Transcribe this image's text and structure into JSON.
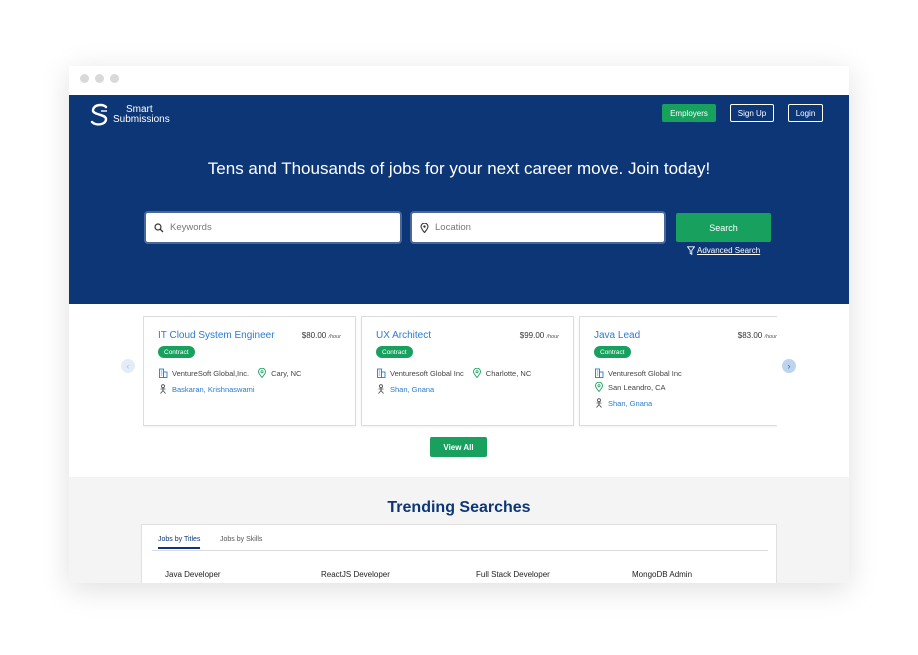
{
  "colors": {
    "brand_navy": "#0d3677",
    "accent_green": "#18a05e",
    "link_blue": "#2a7bd0"
  },
  "logo": {
    "line1": "Smart",
    "line2": "Submissions",
    "icon": "s-logo-icon"
  },
  "nav": {
    "employers": "Employers",
    "signup": "Sign Up",
    "login": "Login"
  },
  "hero": {
    "headline": "Tens and Thousands of jobs for your next career move. Join today!"
  },
  "search": {
    "keywords_placeholder": "Keywords",
    "location_placeholder": "Location",
    "button": "Search",
    "advanced": "Advanced Search"
  },
  "jobs": [
    {
      "title": "IT Cloud System Engineer",
      "rate": "$80.00",
      "rate_unit": "/hour",
      "type": "Contract",
      "company": "VentureSoft Global,Inc.",
      "location": "Cary, NC",
      "contact": "Baskaran, Krishnaswami"
    },
    {
      "title": "UX Architect",
      "rate": "$99.00",
      "rate_unit": "/hour",
      "type": "Contract",
      "company": "Venturesoft Global Inc",
      "location": "Charlotte, NC",
      "contact": "Shan, Gnana"
    },
    {
      "title": "Java Lead",
      "rate": "$83.00",
      "rate_unit": "/hour",
      "type": "Contract",
      "company": "Venturesoft Global Inc",
      "location": "San Leandro, CA",
      "contact": "Shan, Gnana"
    }
  ],
  "view_all": "View All",
  "trending": {
    "heading": "Trending Searches",
    "tabs": [
      "Jobs by Titles",
      "Jobs by Skills"
    ],
    "items": [
      "Java Developer",
      "ReactJS Developer",
      "Full Stack Developer",
      "MongoDB Admin"
    ]
  }
}
